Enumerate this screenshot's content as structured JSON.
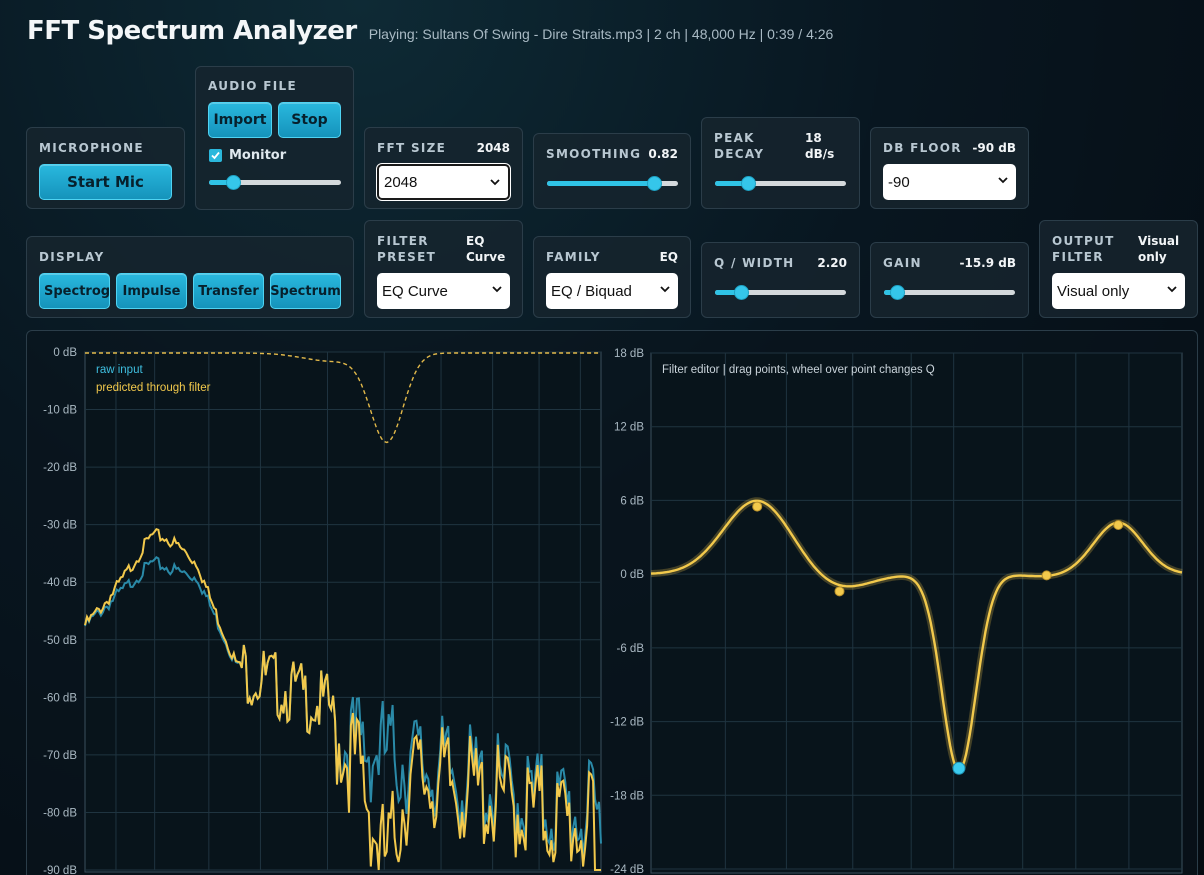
{
  "header": {
    "title": "FFT Spectrum Analyzer",
    "now_playing": "Playing: Sultans Of Swing - Dire Straits.mp3 | 2 ch | 48,000 Hz | 0:39 / 4:26"
  },
  "microphone": {
    "label": "MICROPHONE",
    "start_button": "Start Mic"
  },
  "audio_file": {
    "label": "AUDIO FILE",
    "import_button": "Import",
    "stop_button": "Stop",
    "monitor_label": "Monitor",
    "monitor_checked": true,
    "volume": 0.18
  },
  "fft_size": {
    "label": "FFT SIZE",
    "value": "2048",
    "selected": "2048"
  },
  "smoothing": {
    "label": "SMOOTHING",
    "value": "0.82",
    "level": 0.82
  },
  "peak_decay": {
    "label_1": "PEAK",
    "label_2": "DECAY",
    "value_1": "18",
    "value_2": "dB/s",
    "level": 0.25
  },
  "db_floor": {
    "label": "DB FLOOR",
    "value": "-90 dB",
    "selected": "-90"
  },
  "display": {
    "label": "DISPLAY",
    "buttons": [
      "Spectrogram",
      "Impulse",
      "Transfer",
      "Spectrum"
    ]
  },
  "filter_preset": {
    "label_1": "FILTER",
    "label_2": "PRESET",
    "value_1": "EQ",
    "value_2": "Curve",
    "selected": "EQ Curve"
  },
  "family": {
    "label": "FAMILY",
    "value": "EQ",
    "selected": "EQ / Biquad"
  },
  "q_width": {
    "label": "Q / WIDTH",
    "value": "2.20",
    "level": 0.2
  },
  "gain": {
    "label": "GAIN",
    "value": "-15.9 dB",
    "level": 0.1
  },
  "output_filter": {
    "label_1": "OUTPUT",
    "label_2": "FILTER",
    "value_1": "Visual",
    "value_2": "only",
    "selected": "Visual only"
  },
  "colors": {
    "accent": "#2fc3e6",
    "filter": "#f2c94c",
    "raw": "#2a8aa8"
  },
  "spectrum_plot": {
    "y_ticks": [
      "0 dB",
      "-10 dB",
      "-20 dB",
      "-30 dB",
      "-40 dB",
      "-50 dB",
      "-60 dB",
      "-70 dB",
      "-80 dB",
      "-90 dB"
    ],
    "legend_raw": "raw input",
    "legend_filtered": "predicted through filter"
  },
  "filter_editor": {
    "y_ticks": [
      "18 dB",
      "12 dB",
      "6 dB",
      "0 dB",
      "-6 dB",
      "-12 dB",
      "-18 dB",
      "-24 dB"
    ],
    "caption": "Filter editor | drag points, wheel over point changes Q"
  }
}
